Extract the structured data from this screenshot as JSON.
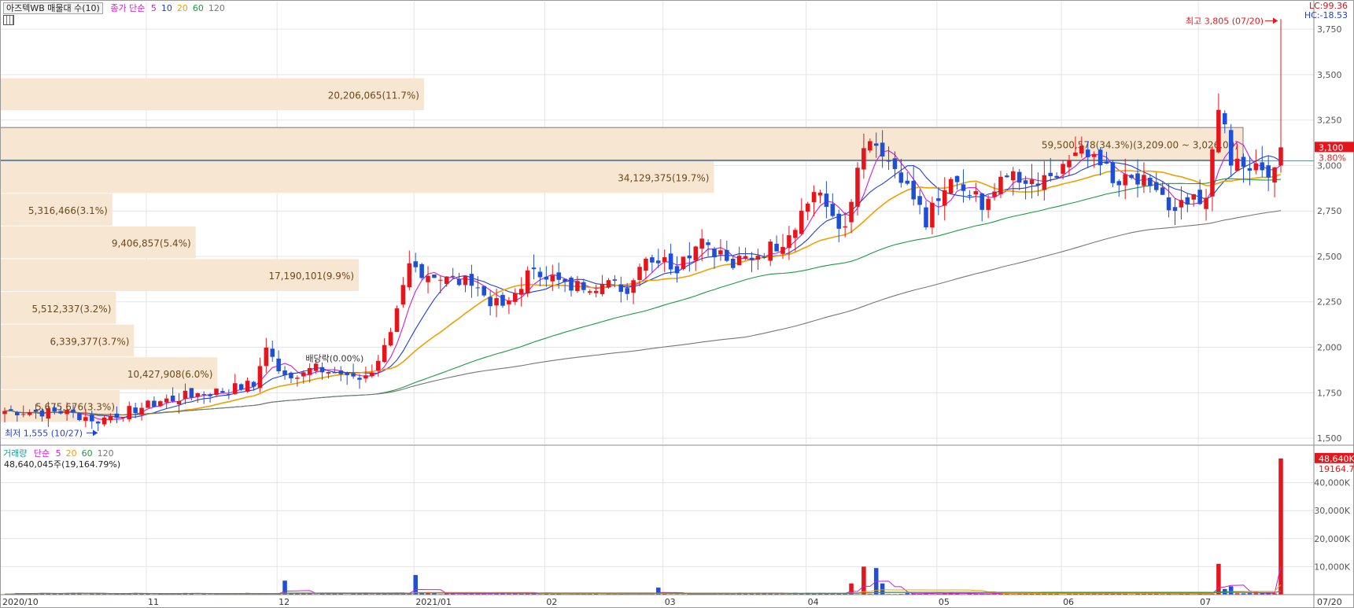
{
  "header": {
    "title": "아즈텍WB 매물대 수(10)",
    "ma_label": "종가 단순",
    "ma_periods": [
      "5",
      "10",
      "20",
      "60",
      "120"
    ],
    "ma_colors": [
      "#d21ad2",
      "#1f3fd6",
      "#f0a000",
      "#1a9a40",
      "#777777"
    ],
    "lc_text": "LC:99.36",
    "hc_text": "HC:-18.53"
  },
  "volume_header": {
    "label": "거래량",
    "ma_label": "단순",
    "ma_periods": [
      "5",
      "20",
      "60",
      "120"
    ],
    "ma_colors": [
      "#d21ad2",
      "#f0a000",
      "#1a9a40",
      "#777777"
    ],
    "value_text": "48,640,045주(19,164.79%)"
  },
  "chart_data": [
    {
      "type": "candlestick",
      "title": "아즈텍WB",
      "ylim": [
        1470,
        3850
      ],
      "y_ticks": [
        "1,500",
        "1,750",
        "2,000",
        "2,250",
        "2,500",
        "2,750",
        "3,000",
        "3,250",
        "3,500",
        "3,750"
      ],
      "x_labels": [
        "2020/10",
        "11",
        "12",
        "2021/01",
        "02",
        "03",
        "04",
        "05",
        "06",
        "07",
        "07/20"
      ],
      "current_price": {
        "label": "3,100",
        "change": "3.80%",
        "value": 3100
      },
      "annotations": {
        "high": {
          "text": "최고 3,805 (07/20)",
          "value": 3805
        },
        "low": {
          "text": "최저 1,555 (10/27)",
          "value": 1555
        },
        "ex_dividend": "배당락(0.00%)"
      },
      "price_level_bands": [
        {
          "label": "20,206,065(11.7%)",
          "from": 3300,
          "to": 3480,
          "pct": 11.7
        },
        {
          "label": "59,500,578(34.3%)(3,209.00 ~ 3,026.00)",
          "from": 3026,
          "to": 3209,
          "pct": 34.3,
          "highlight": true
        },
        {
          "label": "34,129,375(19.7%)",
          "from": 2845,
          "to": 3026,
          "pct": 19.7
        },
        {
          "label": "5,316,466(3.1%)",
          "from": 2665,
          "to": 2845,
          "pct": 3.1
        },
        {
          "label": "9,406,857(5.4%)",
          "from": 2485,
          "to": 2665,
          "pct": 5.4
        },
        {
          "label": "17,190,101(9.9%)",
          "from": 2305,
          "to": 2485,
          "pct": 9.9
        },
        {
          "label": "5,512,337(3.2%)",
          "from": 2125,
          "to": 2305,
          "pct": 3.2
        },
        {
          "label": "6,339,377(3.7%)",
          "from": 1945,
          "to": 2125,
          "pct": 3.7
        },
        {
          "label": "10,427,908(6.0%)",
          "from": 1765,
          "to": 1945,
          "pct": 6.0
        },
        {
          "label": "5,675,676(3.3%)",
          "from": 1585,
          "to": 1765,
          "pct": 3.3
        }
      ],
      "anchors": [
        {
          "i": 0,
          "c": 1650
        },
        {
          "i": 10,
          "c": 1640
        },
        {
          "i": 15,
          "c": 1600
        },
        {
          "i": 20,
          "c": 1650
        },
        {
          "i": 25,
          "c": 1700
        },
        {
          "i": 30,
          "c": 1740
        },
        {
          "i": 35,
          "c": 1760
        },
        {
          "i": 40,
          "c": 1800
        },
        {
          "i": 42,
          "c": 1980
        },
        {
          "i": 45,
          "c": 1850
        },
        {
          "i": 50,
          "c": 1880
        },
        {
          "i": 55,
          "c": 1850
        },
        {
          "i": 58,
          "c": 1830
        },
        {
          "i": 62,
          "c": 2050
        },
        {
          "i": 65,
          "c": 2450
        },
        {
          "i": 70,
          "c": 2380
        },
        {
          "i": 75,
          "c": 2350
        },
        {
          "i": 80,
          "c": 2200
        },
        {
          "i": 85,
          "c": 2450
        },
        {
          "i": 90,
          "c": 2330
        },
        {
          "i": 95,
          "c": 2350
        },
        {
          "i": 100,
          "c": 2330
        },
        {
          "i": 103,
          "c": 2500
        },
        {
          "i": 108,
          "c": 2450
        },
        {
          "i": 112,
          "c": 2600
        },
        {
          "i": 117,
          "c": 2450
        },
        {
          "i": 120,
          "c": 2500
        },
        {
          "i": 125,
          "c": 2580
        },
        {
          "i": 130,
          "c": 2850
        },
        {
          "i": 135,
          "c": 2650
        },
        {
          "i": 138,
          "c": 3100
        },
        {
          "i": 141,
          "c": 3050
        },
        {
          "i": 144,
          "c": 2900
        },
        {
          "i": 148,
          "c": 2700
        },
        {
          "i": 152,
          "c": 2900
        },
        {
          "i": 157,
          "c": 2800
        },
        {
          "i": 162,
          "c": 2950
        },
        {
          "i": 167,
          "c": 2900
        },
        {
          "i": 172,
          "c": 3100
        },
        {
          "i": 175,
          "c": 3050
        },
        {
          "i": 179,
          "c": 2900
        },
        {
          "i": 183,
          "c": 2950
        },
        {
          "i": 187,
          "c": 2800
        },
        {
          "i": 190,
          "c": 2780
        },
        {
          "i": 193,
          "c": 2850
        },
        {
          "i": 195,
          "c": 3350
        },
        {
          "i": 197,
          "c": 3050
        },
        {
          "i": 200,
          "c": 3000
        },
        {
          "i": 204,
          "c": 2950
        },
        {
          "i": 205,
          "c": 3100
        }
      ],
      "last_high": 3805,
      "series": [
        {
          "name": "5",
          "period": 5,
          "color": "#d21ad2"
        },
        {
          "name": "10",
          "period": 10,
          "color": "#1f3fd6"
        },
        {
          "name": "20",
          "period": 20,
          "color": "#f0a000"
        },
        {
          "name": "60",
          "period": 60,
          "color": "#1a9a40"
        },
        {
          "name": "120",
          "period": 120,
          "color": "#777777"
        }
      ]
    },
    {
      "type": "bar",
      "title": "거래량",
      "ylim": [
        0,
        50000
      ],
      "y_ticks": [
        "10,000K",
        "20,000K",
        "30,000K",
        "40,000K"
      ],
      "current": {
        "label": "48,640K",
        "pct": "19164.79%",
        "value": 48640
      },
      "spikes": [
        {
          "i": 45,
          "v": 5000
        },
        {
          "i": 66,
          "v": 7000
        },
        {
          "i": 105,
          "v": 2500
        },
        {
          "i": 136,
          "v": 4000
        },
        {
          "i": 138,
          "v": 10000
        },
        {
          "i": 140,
          "v": 9500
        },
        {
          "i": 141,
          "v": 4000
        },
        {
          "i": 195,
          "v": 11000
        },
        {
          "i": 196,
          "v": 2000
        },
        {
          "i": 197,
          "v": 3000
        },
        {
          "i": 205,
          "v": 48640
        }
      ]
    }
  ]
}
